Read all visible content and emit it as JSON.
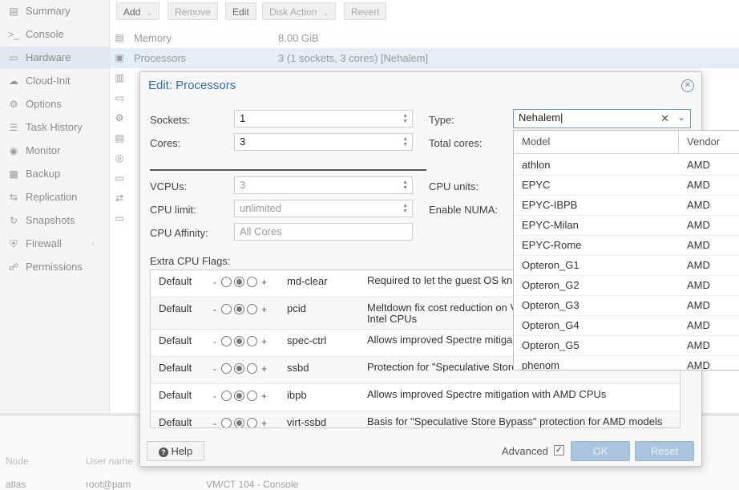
{
  "sidebar": {
    "items": [
      {
        "label": "Summary",
        "icon": "document-icon"
      },
      {
        "label": "Console",
        "icon": "terminal-icon"
      },
      {
        "label": "Hardware",
        "icon": "monitor-icon"
      },
      {
        "label": "Cloud-Init",
        "icon": "cloud-icon"
      },
      {
        "label": "Options",
        "icon": "gear-icon"
      },
      {
        "label": "Task History",
        "icon": "list-icon"
      },
      {
        "label": "Monitor",
        "icon": "eye-icon"
      },
      {
        "label": "Backup",
        "icon": "floppy-icon"
      },
      {
        "label": "Replication",
        "icon": "retweet-icon"
      },
      {
        "label": "Snapshots",
        "icon": "history-icon"
      },
      {
        "label": "Firewall",
        "icon": "shield-icon"
      },
      {
        "label": "Permissions",
        "icon": "unlock-icon"
      }
    ],
    "active": "Hardware"
  },
  "toolbar": {
    "add": "Add",
    "remove": "Remove",
    "edit": "Edit",
    "disk_action": "Disk Action",
    "revert": "Revert"
  },
  "hardware": {
    "rows": [
      {
        "name": "Memory",
        "value": "8.00 GiB"
      },
      {
        "name": "Processors",
        "value": "3 (1 sockets, 3 cores) [Nehalem]"
      }
    ]
  },
  "log": {
    "headers": {
      "node": "Node",
      "user": "User name"
    },
    "row": {
      "node": "atlas",
      "user": "root@pam",
      "desc": "VM/CT 104 - Console"
    }
  },
  "dialog": {
    "title": "Edit: Processors",
    "sockets_label": "Sockets:",
    "sockets_value": "1",
    "cores_label": "Cores:",
    "cores_value": "3",
    "type_label": "Type:",
    "type_value": "Nehalem",
    "total_cores_label": "Total cores:",
    "vcpus_label": "VCPUs:",
    "vcpus_value": "3",
    "cpu_units_label": "CPU units:",
    "cpu_limit_label": "CPU limit:",
    "cpu_limit_value": "unlimited",
    "numa_label": "Enable NUMA:",
    "affinity_label": "CPU Affinity:",
    "affinity_placeholder": "All Cores",
    "flags_label": "Extra CPU Flags:",
    "flags": [
      {
        "state": "Default",
        "name": "md-clear",
        "desc": "Required to let the guest OS kn"
      },
      {
        "state": "Default",
        "name": "pcid",
        "desc": "Meltdown fix cost reduction on V\nIntel CPUs"
      },
      {
        "state": "Default",
        "name": "spec-ctrl",
        "desc": "Allows improved Spectre mitiga"
      },
      {
        "state": "Default",
        "name": "ssbd",
        "desc": "Protection for \"Speculative Store"
      },
      {
        "state": "Default",
        "name": "ibpb",
        "desc": "Allows improved Spectre mitigation with AMD CPUs"
      },
      {
        "state": "Default",
        "name": "virt-ssbd",
        "desc": "Basis for \"Speculative Store Bypass\" protection for AMD models"
      }
    ],
    "help": "Help",
    "advanced": "Advanced",
    "ok": "OK",
    "reset": "Reset"
  },
  "dropdown": {
    "col_model": "Model",
    "col_vendor": "Vendor",
    "rows": [
      {
        "model": "athlon",
        "vendor": "AMD"
      },
      {
        "model": "EPYC",
        "vendor": "AMD"
      },
      {
        "model": "EPYC-IBPB",
        "vendor": "AMD"
      },
      {
        "model": "EPYC-Milan",
        "vendor": "AMD"
      },
      {
        "model": "EPYC-Rome",
        "vendor": "AMD"
      },
      {
        "model": "Opteron_G1",
        "vendor": "AMD"
      },
      {
        "model": "Opteron_G2",
        "vendor": "AMD"
      },
      {
        "model": "Opteron_G3",
        "vendor": "AMD"
      },
      {
        "model": "Opteron_G4",
        "vendor": "AMD"
      },
      {
        "model": "Opteron_G5",
        "vendor": "AMD"
      },
      {
        "model": "phenom",
        "vendor": "AMD"
      }
    ]
  },
  "colors": {
    "accent": "#2f6fab",
    "selected_row": "#e4eef6",
    "primary_button": "#a9c4de"
  }
}
